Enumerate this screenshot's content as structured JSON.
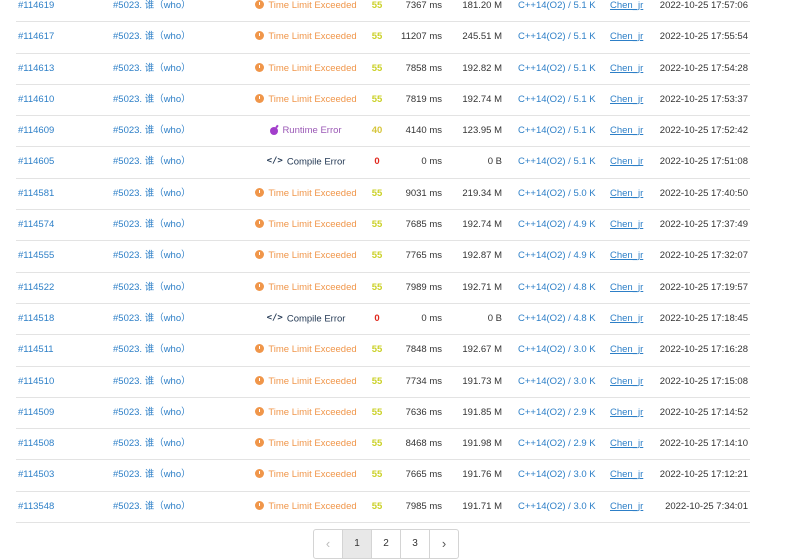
{
  "rows": [
    {
      "id": "#114619",
      "problem": "#5023. 谁（who）",
      "status": "Time Limit Exceeded",
      "status_type": "tle",
      "score": "55",
      "time": "7367 ms",
      "memory": "181.20 M",
      "language": "C++14(O2) / 5.1 K",
      "user": "Chen_jr",
      "date": "2022-10-25 17:57:06"
    },
    {
      "id": "#114617",
      "problem": "#5023. 谁（who）",
      "status": "Time Limit Exceeded",
      "status_type": "tle",
      "score": "55",
      "time": "11207 ms",
      "memory": "245.51 M",
      "language": "C++14(O2) / 5.1 K",
      "user": "Chen_jr",
      "date": "2022-10-25 17:55:54"
    },
    {
      "id": "#114613",
      "problem": "#5023. 谁（who）",
      "status": "Time Limit Exceeded",
      "status_type": "tle",
      "score": "55",
      "time": "7858 ms",
      "memory": "192.82 M",
      "language": "C++14(O2) / 5.1 K",
      "user": "Chen_jr",
      "date": "2022-10-25 17:54:28"
    },
    {
      "id": "#114610",
      "problem": "#5023. 谁（who）",
      "status": "Time Limit Exceeded",
      "status_type": "tle",
      "score": "55",
      "time": "7819 ms",
      "memory": "192.74 M",
      "language": "C++14(O2) / 5.1 K",
      "user": "Chen_jr",
      "date": "2022-10-25 17:53:37"
    },
    {
      "id": "#114609",
      "problem": "#5023. 谁（who）",
      "status": "Runtime Error",
      "status_type": "re",
      "score": "40",
      "time": "4140 ms",
      "memory": "123.95 M",
      "language": "C++14(O2) / 5.1 K",
      "user": "Chen_jr",
      "date": "2022-10-25 17:52:42"
    },
    {
      "id": "#114605",
      "problem": "#5023. 谁（who）",
      "status": "Compile Error",
      "status_type": "ce",
      "score": "0",
      "time": "0 ms",
      "memory": "0 B",
      "language": "C++14(O2) / 5.1 K",
      "user": "Chen_jr",
      "date": "2022-10-25 17:51:08"
    },
    {
      "id": "#114581",
      "problem": "#5023. 谁（who）",
      "status": "Time Limit Exceeded",
      "status_type": "tle",
      "score": "55",
      "time": "9031 ms",
      "memory": "219.34 M",
      "language": "C++14(O2) / 5.0 K",
      "user": "Chen_jr",
      "date": "2022-10-25 17:40:50"
    },
    {
      "id": "#114574",
      "problem": "#5023. 谁（who）",
      "status": "Time Limit Exceeded",
      "status_type": "tle",
      "score": "55",
      "time": "7685 ms",
      "memory": "192.74 M",
      "language": "C++14(O2) / 4.9 K",
      "user": "Chen_jr",
      "date": "2022-10-25 17:37:49"
    },
    {
      "id": "#114555",
      "problem": "#5023. 谁（who）",
      "status": "Time Limit Exceeded",
      "status_type": "tle",
      "score": "55",
      "time": "7765 ms",
      "memory": "192.87 M",
      "language": "C++14(O2) / 4.9 K",
      "user": "Chen_jr",
      "date": "2022-10-25 17:32:07"
    },
    {
      "id": "#114522",
      "problem": "#5023. 谁（who）",
      "status": "Time Limit Exceeded",
      "status_type": "tle",
      "score": "55",
      "time": "7989 ms",
      "memory": "192.71 M",
      "language": "C++14(O2) / 4.8 K",
      "user": "Chen_jr",
      "date": "2022-10-25 17:19:57"
    },
    {
      "id": "#114518",
      "problem": "#5023. 谁（who）",
      "status": "Compile Error",
      "status_type": "ce",
      "score": "0",
      "time": "0 ms",
      "memory": "0 B",
      "language": "C++14(O2) / 4.8 K",
      "user": "Chen_jr",
      "date": "2022-10-25 17:18:45"
    },
    {
      "id": "#114511",
      "problem": "#5023. 谁（who）",
      "status": "Time Limit Exceeded",
      "status_type": "tle",
      "score": "55",
      "time": "7848 ms",
      "memory": "192.67 M",
      "language": "C++14(O2) / 3.0 K",
      "user": "Chen_jr",
      "date": "2022-10-25 17:16:28"
    },
    {
      "id": "#114510",
      "problem": "#5023. 谁（who）",
      "status": "Time Limit Exceeded",
      "status_type": "tle",
      "score": "55",
      "time": "7734 ms",
      "memory": "191.73 M",
      "language": "C++14(O2) / 3.0 K",
      "user": "Chen_jr",
      "date": "2022-10-25 17:15:08"
    },
    {
      "id": "#114509",
      "problem": "#5023. 谁（who）",
      "status": "Time Limit Exceeded",
      "status_type": "tle",
      "score": "55",
      "time": "7636 ms",
      "memory": "191.85 M",
      "language": "C++14(O2) / 2.9 K",
      "user": "Chen_jr",
      "date": "2022-10-25 17:14:52"
    },
    {
      "id": "#114508",
      "problem": "#5023. 谁（who）",
      "status": "Time Limit Exceeded",
      "status_type": "tle",
      "score": "55",
      "time": "8468 ms",
      "memory": "191.98 M",
      "language": "C++14(O2) / 2.9 K",
      "user": "Chen_jr",
      "date": "2022-10-25 17:14:10"
    },
    {
      "id": "#114503",
      "problem": "#5023. 谁（who）",
      "status": "Time Limit Exceeded",
      "status_type": "tle",
      "score": "55",
      "time": "7665 ms",
      "memory": "191.76 M",
      "language": "C++14(O2) / 3.0 K",
      "user": "Chen_jr",
      "date": "2022-10-25 17:12:21"
    },
    {
      "id": "#113548",
      "problem": "#5023. 谁（who）",
      "status": "Time Limit Exceeded",
      "status_type": "tle",
      "score": "55",
      "time": "7985 ms",
      "memory": "191.71 M",
      "language": "C++14(O2) / 3.0 K",
      "user": "Chen_jr",
      "date": "2022-10-25 7:34:01"
    }
  ],
  "status_icons": {
    "tle": "clock-icon",
    "re": "bomb-icon",
    "ce": "code-icon"
  },
  "colors": {
    "link": "#2d7fc7",
    "tle": "#f0964a",
    "runtime_error": "#9b59b6",
    "compile_error": "#253a55",
    "score_zero": "#e0281d",
    "score_partial": "#cbd128"
  },
  "pagination": {
    "prev": "‹",
    "pages": [
      "1",
      "2",
      "3"
    ],
    "current": "1",
    "next": "›"
  }
}
